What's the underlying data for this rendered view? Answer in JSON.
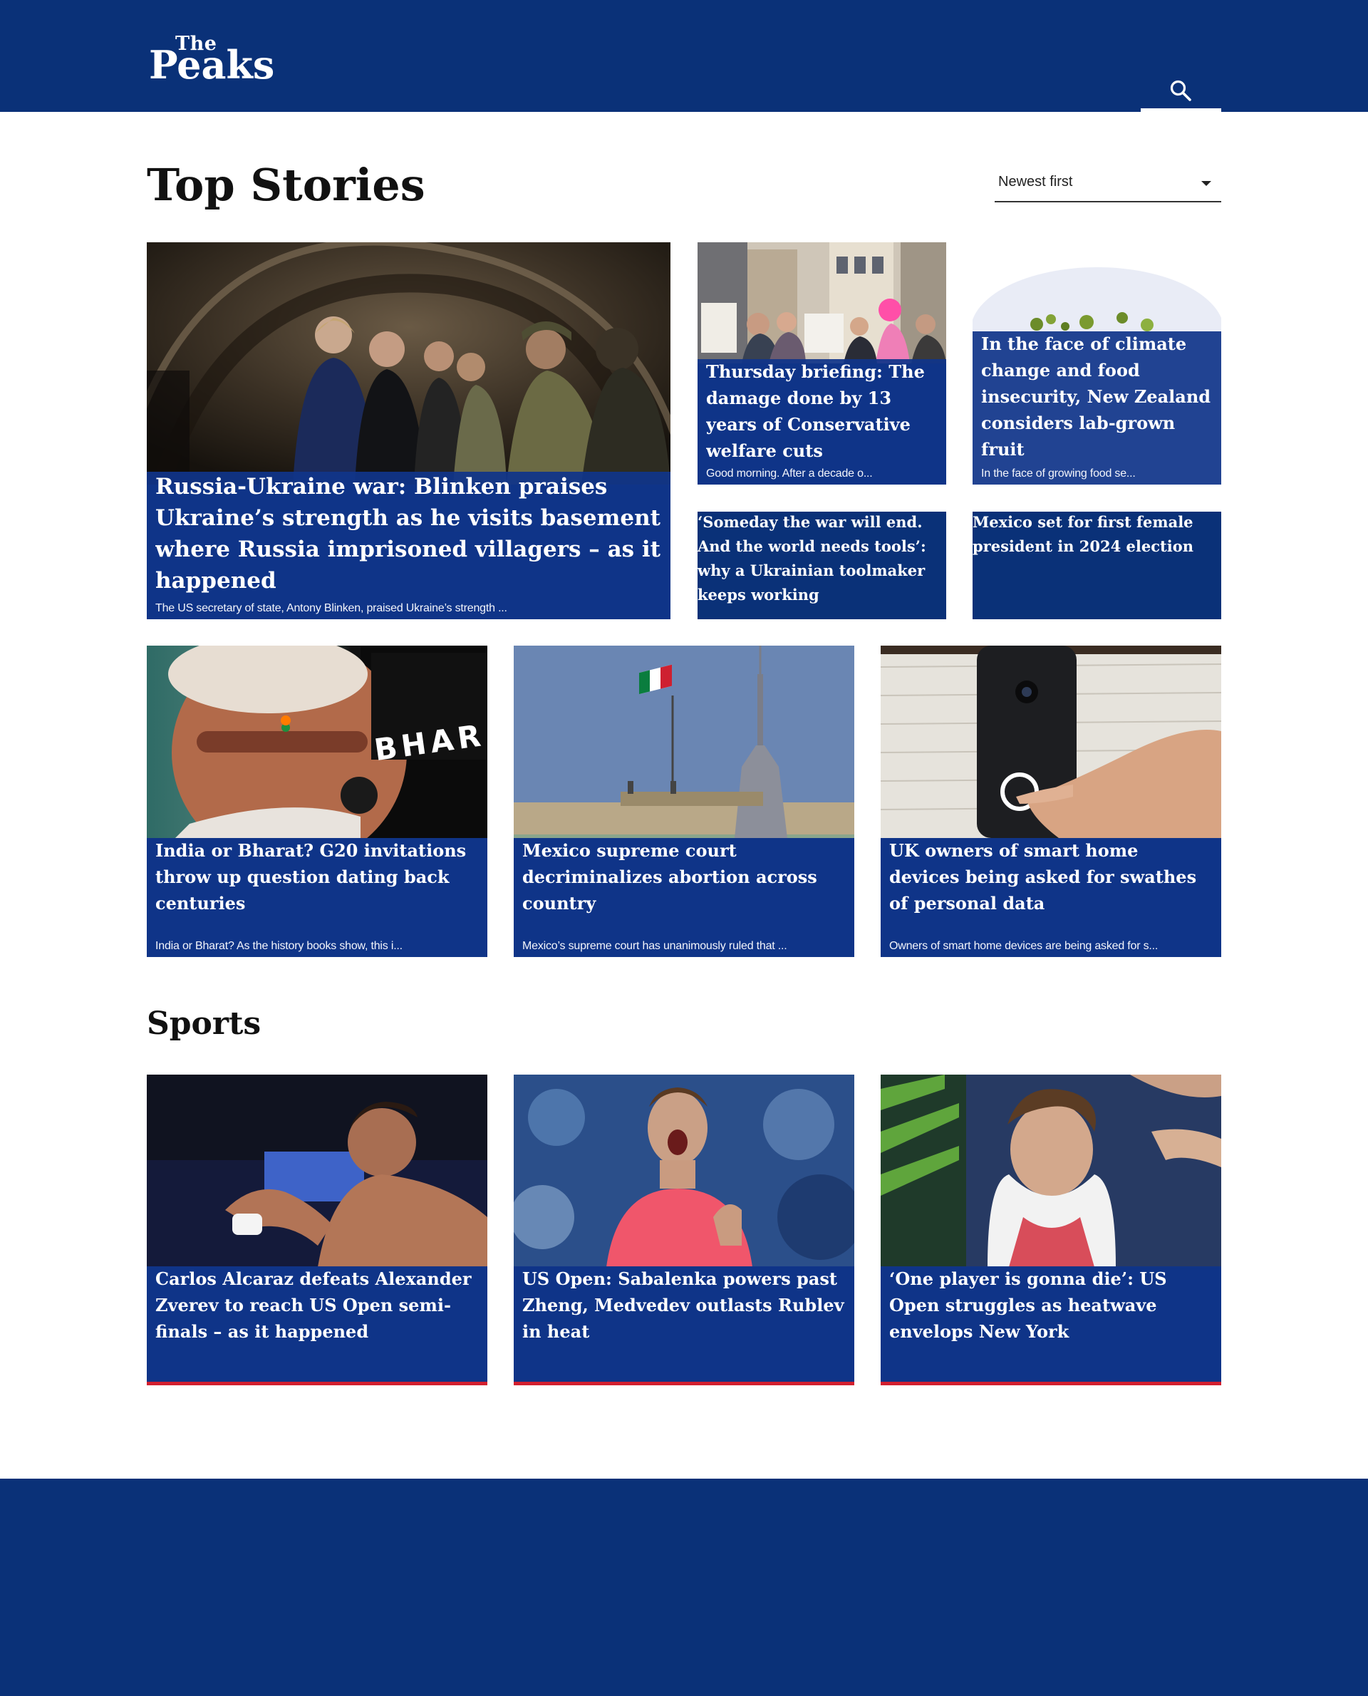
{
  "brand": {
    "the": "The",
    "name": "Peaks",
    "primary": "#0a3178",
    "accent": "#d21f2f"
  },
  "header": {
    "search_icon": "search-icon"
  },
  "top_stories": {
    "title": "Top Stories",
    "sort": {
      "selected": "Newest first"
    },
    "featured": {
      "headline": "Russia-Ukraine war: Blinken praises Ukraine’s strength as he visits basement where Russia imprisoned villagers – as it happened",
      "summary": "The US secretary of state, Antony Blinken, praised Ukraine’s strength ..."
    },
    "small": [
      {
        "headline": "Thursday briefing: The damage done by 13 years of Conservative welfare cuts",
        "summary": "Good morning. After a decade o..."
      },
      {
        "headline": "In the face of climate change and food insecurity, New Zealand considers lab-grown fruit",
        "summary": "In the face of growing food se..."
      },
      {
        "headline": "‘Someday the war will end. And the world needs tools’: why a Ukrainian toolmaker keeps working"
      },
      {
        "headline": "Mexico set for first female president in 2024 election"
      }
    ],
    "row": [
      {
        "headline": "India or Bharat? G20 invitations throw up question dating back centuries",
        "summary": "India or Bharat? As the history books show, this i..."
      },
      {
        "headline": "Mexico supreme court decriminalizes abortion across country",
        "summary": "Mexico’s supreme court has unanimously ruled that ..."
      },
      {
        "headline": "UK owners of smart home devices being asked for swathes of personal data",
        "summary": "Owners of smart home devices are being asked for s..."
      }
    ]
  },
  "sports": {
    "title": "Sports",
    "cards": [
      {
        "headline": "Carlos Alcaraz defeats Alexander Zverev to reach US Open semi-finals – as it happened"
      },
      {
        "headline": "US Open: Sabalenka powers past Zheng, Medvedev outlasts Rublev in heat"
      },
      {
        "headline": "‘One player is gonna die’: US Open struggles as heatwave envelops New York"
      }
    ]
  },
  "image_text": {
    "bharat": "BHAR"
  }
}
